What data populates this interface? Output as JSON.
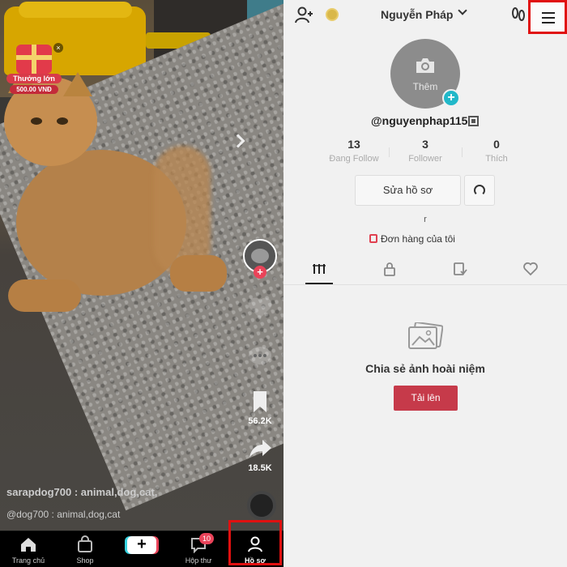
{
  "left": {
    "reward": {
      "title": "Thưởng lớn",
      "amount": "500.00 VNĐ"
    },
    "rail": {
      "bookmark_count": "56.2K",
      "share_count": "18.5K"
    },
    "caption": "sarapdog700 : animal,dog,cat,",
    "caption2": "@dog700 : animal,dog,cat",
    "nav": {
      "home": "Trang chủ",
      "shop": "Shop",
      "inbox": "Hộp thư",
      "inbox_badge": "10",
      "profile": "Hồ sơ"
    }
  },
  "right": {
    "username": "Nguyễn Pháp",
    "photo_label": "Thêm",
    "handle": "@nguyenphap115",
    "stats": [
      {
        "num": "13",
        "label": "Đang Follow"
      },
      {
        "num": "3",
        "label": "Follower"
      },
      {
        "num": "0",
        "label": "Thích"
      }
    ],
    "edit_label": "Sửa hồ sơ",
    "bio": "r",
    "orders_label": "Đơn hàng của tôi",
    "empty_title": "Chia sẻ ảnh hoài niệm",
    "upload_label": "Tải lên"
  },
  "colors": {
    "accent": "#ea4359",
    "highlight": "#e01010",
    "teal": "#21b8c9"
  }
}
